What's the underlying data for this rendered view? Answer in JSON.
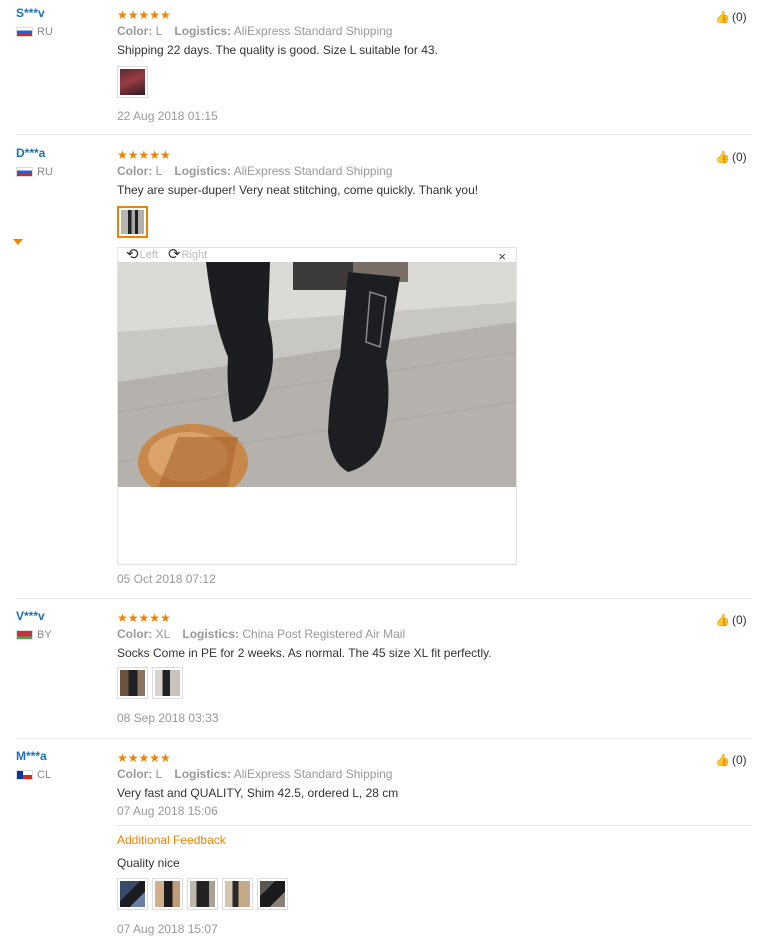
{
  "reviews": [
    {
      "user": "S***v",
      "country": "RU",
      "stars": "★★★★★",
      "color_label": "Color:",
      "color": "L",
      "logistics_label": "Logistics:",
      "logistics": "AliExpress Standard Shipping",
      "text": "Shipping 22 days. The quality is good. Size L suitable for 43.",
      "date": "22 Aug 2018 01:15",
      "helpful": "(0)"
    },
    {
      "user": "D***a",
      "country": "RU",
      "stars": "★★★★★",
      "color_label": "Color:",
      "color": "L",
      "logistics_label": "Logistics:",
      "logistics": "AliExpress Standard Shipping",
      "text": "They are super-duper! Very neat stitching, come quickly. Thank you!",
      "date": "05 Oct 2018 07:12",
      "helpful": "(0)"
    },
    {
      "user": "V***v",
      "country": "BY",
      "stars": "★★★★★",
      "color_label": "Color:",
      "color": "XL",
      "logistics_label": "Logistics:",
      "logistics": "China Post Registered Air Mail",
      "text": "Socks Come in PE for 2 weeks. As normal. The 45 size XL fit perfectly.",
      "date": "08 Sep 2018 03:33",
      "helpful": "(0)"
    },
    {
      "user": "M***a",
      "country": "CL",
      "stars": "★★★★★",
      "color_label": "Color:",
      "color": "L",
      "logistics_label": "Logistics:",
      "logistics": "AliExpress Standard Shipping",
      "text": "Very fast and QUALITY, Shim 42.5, ordered L, 28 cm",
      "date": "07 Aug 2018 15:06",
      "helpful": "(0)",
      "additional_label": "Additional Feedback",
      "additional_text": "Quality nice",
      "additional_date": "07 Aug 2018 15:07"
    }
  ],
  "viewer": {
    "rotate_left": "Left",
    "rotate_right": "Right",
    "close": "×"
  },
  "colors": {
    "accent": "#f08200",
    "username": "#1d6fb8"
  }
}
